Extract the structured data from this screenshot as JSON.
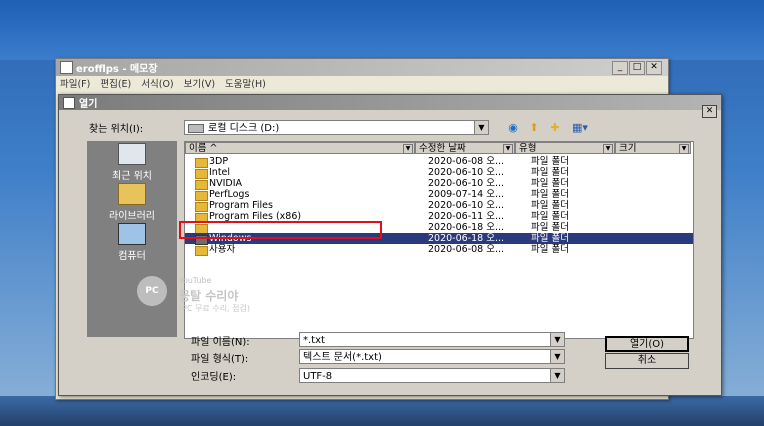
{
  "notepad": {
    "title": "erofflps - 메모장",
    "menu": [
      "파일(F)",
      "편집(E)",
      "서식(O)",
      "보기(V)",
      "도움말(H)"
    ]
  },
  "dialog": {
    "title": "열기",
    "look_in_label": "찾는 위치(I):",
    "look_in_value": "로컬 디스크 (D:)",
    "places": [
      "최근 위치",
      "라이브러리",
      "컴퓨터"
    ],
    "columns": [
      "이름",
      "수정한 날짜",
      "유형",
      "크기"
    ],
    "files": [
      {
        "name": "3DP",
        "date": "2020-06-08 오...",
        "type": "파일 폴더"
      },
      {
        "name": "Intel",
        "date": "2020-06-10 오...",
        "type": "파일 폴더"
      },
      {
        "name": "NVIDIA",
        "date": "2020-06-10 오...",
        "type": "파일 폴더"
      },
      {
        "name": "PerfLogs",
        "date": "2009-07-14 오...",
        "type": "파일 폴더"
      },
      {
        "name": "Program Files",
        "date": "2020-06-10 오...",
        "type": "파일 폴더"
      },
      {
        "name": "Program Files (x86)",
        "date": "2020-06-11 오...",
        "type": "파일 폴더"
      },
      {
        "name": "",
        "date": "2020-06-18 오...",
        "type": "파일 폴더"
      },
      {
        "name": "Windows",
        "date": "2020-06-18 오...",
        "type": "파일 폴더",
        "selected": true
      },
      {
        "name": "사용자",
        "date": "2020-06-08 오...",
        "type": "파일 폴더"
      }
    ],
    "filename_label": "파일 이름(N):",
    "filename_value": "*.txt",
    "filetype_label": "파일 형식(T):",
    "filetype_value": "텍스트 문서(*.txt)",
    "encoding_label": "인코딩(E):",
    "encoding_value": "UTF-8",
    "open_button": "열기(O)",
    "cancel_button": "취소"
  },
  "watermark": {
    "logo": "PC",
    "platform": "YouTube",
    "name": "뭉탈 수리야",
    "subtitle": "(PC 무료 수리, 점검)"
  },
  "colors": {
    "selection": "#2b3a7a",
    "highlight_box": "#e20e1c"
  }
}
